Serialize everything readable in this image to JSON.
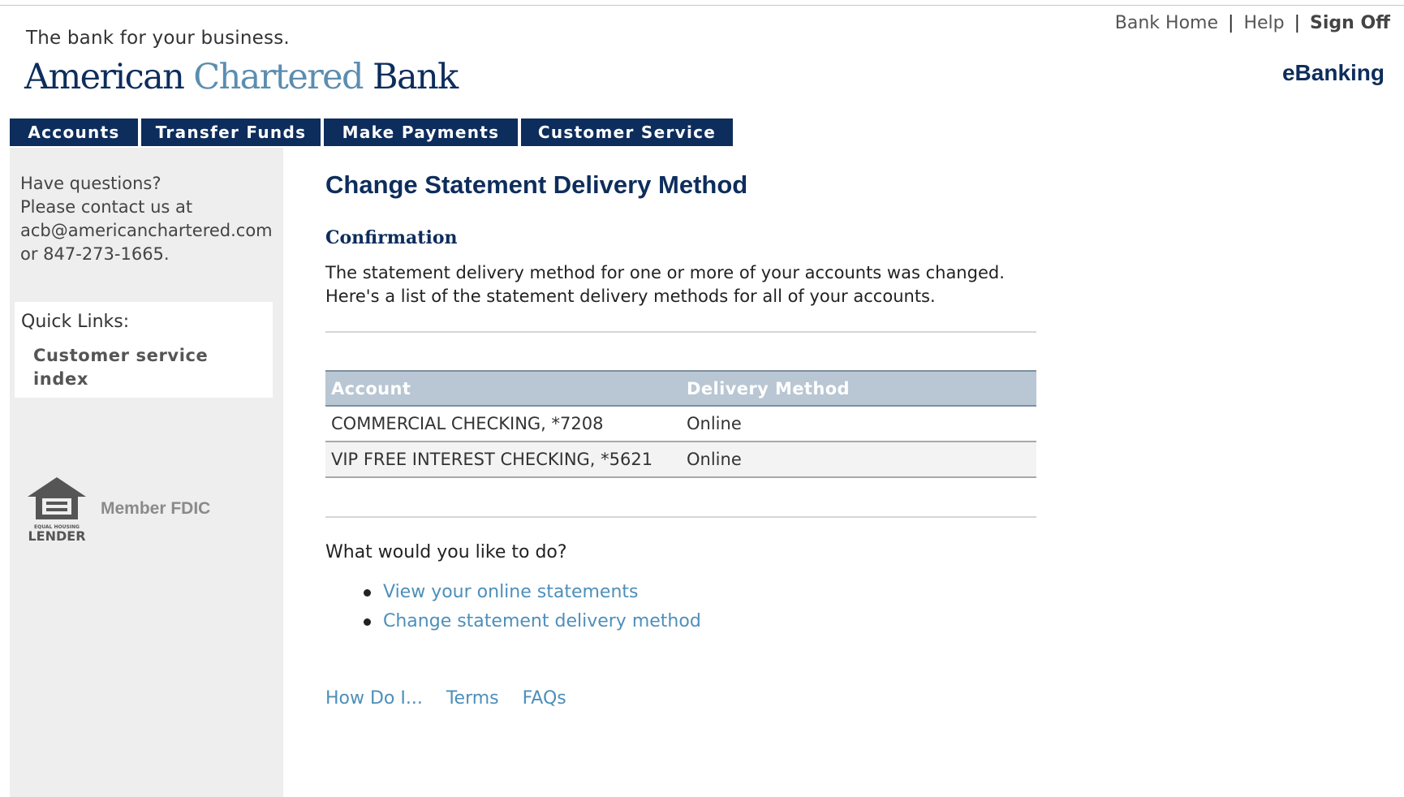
{
  "header": {
    "tagline": "The bank for your business.",
    "logo": {
      "part1": "American",
      "part2": "Chartered",
      "part3": "Bank"
    },
    "util_links": {
      "home": "Bank Home",
      "help": "Help",
      "sign_off": "Sign Off",
      "separator": "|"
    },
    "section_label": "eBanking"
  },
  "nav": {
    "tabs": [
      {
        "label": "Accounts"
      },
      {
        "label": "Transfer Funds"
      },
      {
        "label": "Make Payments"
      },
      {
        "label": "Customer Service"
      }
    ]
  },
  "sidebar": {
    "help_lines": [
      "Have questions?",
      "Please contact us at",
      "acb@americanchartered.com",
      "or 847-273-1665."
    ],
    "quick_links": {
      "title": "Quick Links:",
      "items": [
        {
          "label": "Customer service index"
        }
      ]
    },
    "ehl_logo_text": {
      "top": "EQUAL HOUSING",
      "bottom": "LENDER"
    },
    "fdic": "Member FDIC"
  },
  "main": {
    "title": "Change Statement Delivery Method",
    "subtitle": "Confirmation",
    "confirmation_text": "The statement delivery method for one or more of your accounts was changed. Here's a list of the statement delivery methods for all of your accounts.",
    "table": {
      "headers": {
        "account": "Account",
        "method": "Delivery Method"
      },
      "rows": [
        {
          "account": "COMMERCIAL CHECKING, *7208",
          "method": "Online"
        },
        {
          "account": "VIP FREE INTEREST CHECKING, *5621",
          "method": "Online"
        }
      ]
    },
    "prompt": "What would you like to do?",
    "actions": [
      {
        "label": "View your online statements"
      },
      {
        "label": "Change statement delivery method"
      }
    ],
    "footer_links": [
      {
        "label": "How Do I..."
      },
      {
        "label": "Terms"
      },
      {
        "label": "FAQs"
      }
    ]
  },
  "colors": {
    "brand_navy": "#0d2d5c",
    "brand_light_blue": "#5b8db0",
    "link_blue": "#4d8fba",
    "table_header": "#b9c6d3",
    "sidebar_bg": "#eeeeee"
  }
}
